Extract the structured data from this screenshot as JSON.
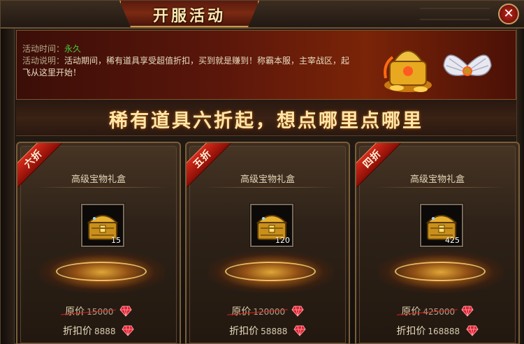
{
  "window": {
    "title": "开服活动",
    "close_icon": "close-icon"
  },
  "banner": {
    "time_label": "活动时间：",
    "time_value": "永久",
    "desc_label": "活动说明：",
    "desc_text": "活动期间，稀有道具享受超值折扣，买到就是赚到！称霸本服，主宰战区，起飞从这里开始！"
  },
  "headline": "稀有道具六折起，想点哪里点哪里",
  "cards": [
    {
      "ribbon": "六折",
      "title": "高级宝物礼盒",
      "count": "15",
      "orig_label": "原价",
      "orig_price": "15000",
      "disc_label": "折扣价",
      "disc_price": "8888"
    },
    {
      "ribbon": "五折",
      "title": "高级宝物礼盒",
      "count": "120",
      "orig_label": "原价",
      "orig_price": "120000",
      "disc_label": "折扣价",
      "disc_price": "58888"
    },
    {
      "ribbon": "四折",
      "title": "高级宝物礼盒",
      "count": "425",
      "orig_label": "原价",
      "orig_price": "425000",
      "disc_label": "折扣价",
      "disc_price": "168888"
    }
  ],
  "icons": {
    "currency": "red-gem-icon",
    "item": "treasure-chest-icon"
  },
  "colors": {
    "accent_gold": "#ffe7a8",
    "ribbon_red": "#d42a1a",
    "green_value": "#4ac83a",
    "strike_red": "#e0201a"
  }
}
